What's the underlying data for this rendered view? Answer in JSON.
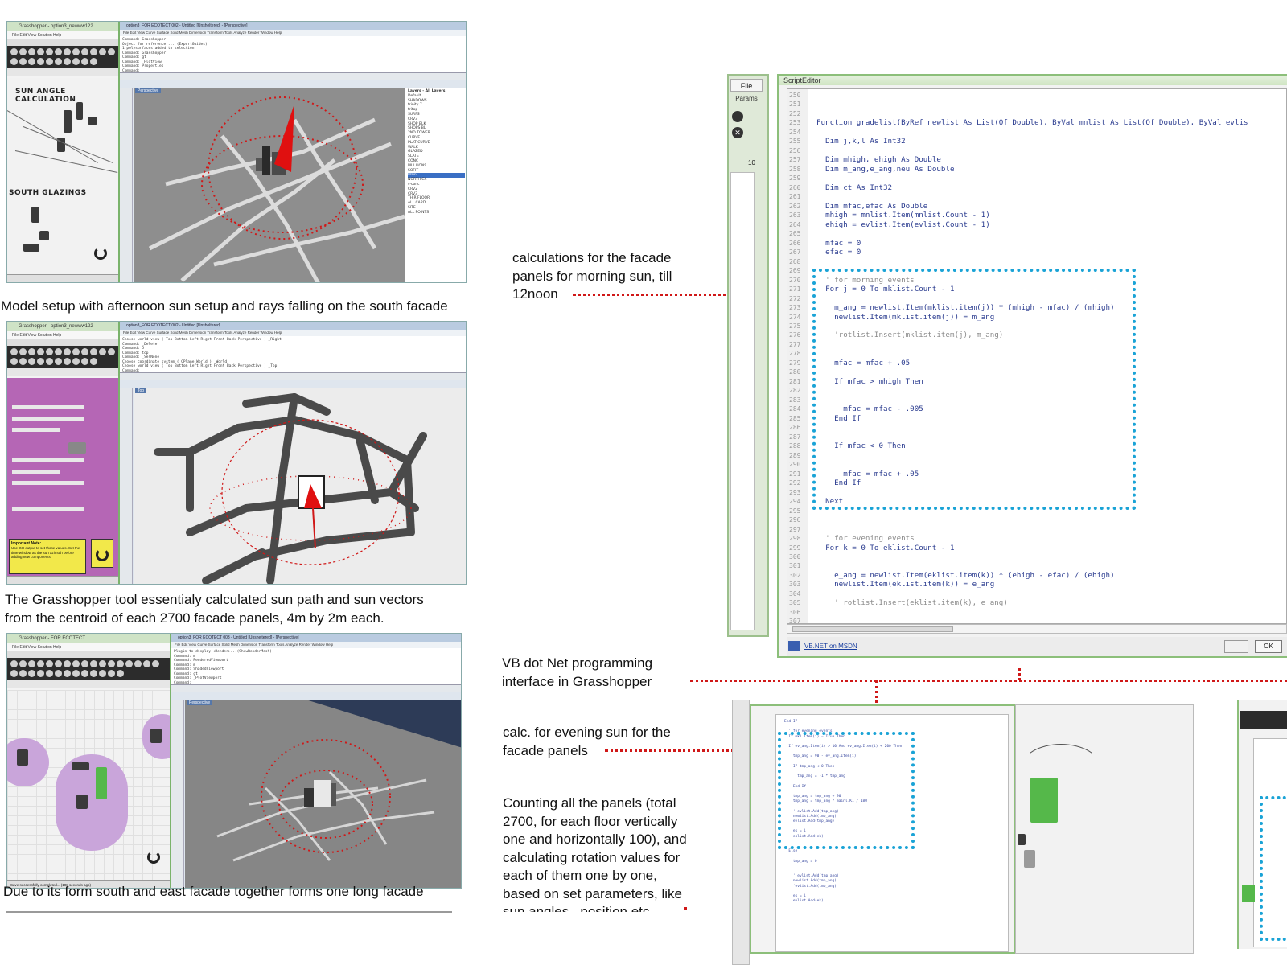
{
  "screens": {
    "top": {
      "gh_title": "Grasshopper - option3_newww122",
      "gh_menu": "File  Edit  View  Solution  Help",
      "label_sun": "SUN ANGLE CALCULATION",
      "label_south": "SOUTH GLAZINGS",
      "rhino_title": "option3_FOR ECOTECT 002 - Untitled [Unsheltered] - [Perspective]",
      "rhino_menu": "File  Edit  View  Curve  Surface  Solid  Mesh  Dimension  Transform  Tools  Analyze  Render  Window  Help",
      "cmd_lines": [
        "Command: Grasshopper",
        "Object for reference ... (ExportGuides)",
        "1 polysurfaces added to selection",
        "Command: Grasshopper",
        "Command: gt",
        "Command: _PlotView",
        "Command: Properties",
        "Command:"
      ],
      "viewport": "Perspective",
      "layers_title": "Layers - All Layers",
      "layers": [
        "Default",
        "SHADOWS",
        "trinity 7",
        "tritop",
        "SURFS",
        "CRV3",
        "SHOP BLK",
        "SHOPS BL",
        "2ND TOWER",
        "CURVE",
        "PLAT CURVE",
        "WALK",
        "GLAZED",
        "SLATE",
        "CONC",
        "MULLIONS",
        "SOFIT",
        "Main",
        "NORTH CX",
        "s-conc",
        "CRV2",
        "CRV3",
        "THIR FLOOR",
        "ALL CARD",
        "SITE",
        "ALL POINTS"
      ]
    },
    "middle": {
      "gh_title": "Grasshopper - option3_newww122",
      "rhino_title": "option3_FOR ECOTECT 002 - Untitled [Unsheltered]",
      "cmd_lines": [
        "Choose world view ( Top Bottom Left Right Front Back Perspective ) _Right",
        "Command: _Delete",
        "Command: 5",
        "Command: top",
        "Command: _SelNone",
        "Choose coordinate system ( CPlane World ) _World",
        "Choose world view ( Top Bottom Left Right Front Back Perspective ) _Top",
        "Command:"
      ],
      "viewport": "Top",
      "panel_title": "Important Note:",
      "panel_text": "Use GH output to set those values. Set the time window as the sun azimuth before adding new components."
    },
    "bottom": {
      "gh_title": "Grasshopper - FOR ECOTECT",
      "gh_tab": "FOR ECOTECT",
      "rhino_title": "option3_FOR ECOTECT 003 - Untitled [Unsheltered] - [Perspective]",
      "cmd_lines": [
        "Plugin to display <Render>...(ShowRenderMesh)",
        "Command: m",
        "Command: RenderedViewport",
        "Command: m",
        "Command: ShadedViewport",
        "Command: gt",
        "Command: _PlotViewport",
        "Command:"
      ],
      "viewport": "Perspective",
      "status": "Save successfully completed... (108 seconds ago)"
    }
  },
  "captions": {
    "c1": "Model setup with afternoon sun setup and rays falling on the south facade",
    "c2a": "The Grasshopper tool essentialy calculated sun path and sun vectors",
    "c2b": "from the centroid of each 2700 facade panels, 4m by 2m each.",
    "c3": "Due to its form south and east facade together forms one long facade"
  },
  "notes": {
    "morning": [
      "calculations for the facade",
      "panels for morning sun, till",
      "12noon"
    ],
    "vbnet": [
      "VB dot Net programming",
      "interface in Grasshopper"
    ],
    "evening": [
      "calc. for evening sun for the",
      "facade panels"
    ],
    "counting": [
      "Counting all the panels (total",
      "2700, for each floor vertically",
      "one and horizontally 100), and",
      "calculating rotation values for",
      "each of them one by one,",
      "based on set parameters, like",
      "sun angles , position etc"
    ]
  },
  "script_editor": {
    "title": "ScriptEditor",
    "file_button": "File",
    "params_label": "Params",
    "zoom": "10",
    "link": "VB.NET on MSDN",
    "ok": "OK",
    "lines": [
      {
        "n": "250",
        "t": ""
      },
      {
        "n": "251",
        "t": ""
      },
      {
        "n": "252",
        "t": ""
      },
      {
        "n": "253",
        "t": "Function gradelist(ByRef newlist As List(Of Double), ByVal mnlist As List(Of Double), ByVal evlis"
      },
      {
        "n": "254",
        "t": ""
      },
      {
        "n": "255",
        "t": "  Dim j,k,l As Int32"
      },
      {
        "n": "256",
        "t": ""
      },
      {
        "n": "257",
        "t": "  Dim mhigh, ehigh As Double"
      },
      {
        "n": "258",
        "t": "  Dim m_ang,e_ang,neu As Double"
      },
      {
        "n": "259",
        "t": ""
      },
      {
        "n": "260",
        "t": "  Dim ct As Int32"
      },
      {
        "n": "261",
        "t": ""
      },
      {
        "n": "262",
        "t": "  Dim mfac,efac As Double"
      },
      {
        "n": "263",
        "t": "  mhigh = mnlist.Item(mnlist.Count - 1)"
      },
      {
        "n": "264",
        "t": "  ehigh = evlist.Item(evlist.Count - 1)"
      },
      {
        "n": "265",
        "t": ""
      },
      {
        "n": "266",
        "t": "  mfac = 0"
      },
      {
        "n": "267",
        "t": "  efac = 0"
      },
      {
        "n": "268",
        "t": ""
      },
      {
        "n": "269",
        "t": ""
      },
      {
        "n": "270",
        "t": "  ' for morning events",
        "c": true
      },
      {
        "n": "271",
        "t": "  For j = 0 To mklist.Count - 1"
      },
      {
        "n": "272",
        "t": ""
      },
      {
        "n": "273",
        "t": "    m_ang = newlist.Item(mklist.item(j)) * (mhigh - mfac) / (mhigh)"
      },
      {
        "n": "274",
        "t": "    newlist.Item(mklist.item(j)) = m_ang"
      },
      {
        "n": "275",
        "t": ""
      },
      {
        "n": "276",
        "t": "    'rotlist.Insert(mklist.item(j), m_ang)",
        "c": true
      },
      {
        "n": "277",
        "t": ""
      },
      {
        "n": "278",
        "t": ""
      },
      {
        "n": "279",
        "t": "    mfac = mfac + .05"
      },
      {
        "n": "280",
        "t": ""
      },
      {
        "n": "281",
        "t": "    If mfac > mhigh Then"
      },
      {
        "n": "282",
        "t": ""
      },
      {
        "n": "283",
        "t": ""
      },
      {
        "n": "284",
        "t": "      mfac = mfac - .005"
      },
      {
        "n": "285",
        "t": "    End If"
      },
      {
        "n": "286",
        "t": ""
      },
      {
        "n": "287",
        "t": ""
      },
      {
        "n": "288",
        "t": "    If mfac < 0 Then"
      },
      {
        "n": "289",
        "t": ""
      },
      {
        "n": "290",
        "t": ""
      },
      {
        "n": "291",
        "t": "      mfac = mfac + .05"
      },
      {
        "n": "292",
        "t": "    End If"
      },
      {
        "n": "293",
        "t": ""
      },
      {
        "n": "294",
        "t": "  Next"
      },
      {
        "n": "295",
        "t": ""
      },
      {
        "n": "296",
        "t": ""
      },
      {
        "n": "297",
        "t": ""
      },
      {
        "n": "298",
        "t": "  ' for evening events",
        "c": true
      },
      {
        "n": "299",
        "t": "  For k = 0 To eklist.Count - 1"
      },
      {
        "n": "300",
        "t": ""
      },
      {
        "n": "301",
        "t": ""
      },
      {
        "n": "302",
        "t": "    e_ang = newlist.Item(eklist.item(k)) * (ehigh - efac) / (ehigh)"
      },
      {
        "n": "303",
        "t": "    newlist.Item(eklist.item(k)) = e_ang"
      },
      {
        "n": "304",
        "t": ""
      },
      {
        "n": "305",
        "t": "    ' rotlist.Insert(eklist.item(k), e_ang)",
        "c": true
      },
      {
        "n": "306",
        "t": ""
      },
      {
        "n": "307",
        "t": ""
      }
    ]
  },
  "small_editor": {
    "lines": [
      "End If",
      "",
      "  ' for evening events",
      "  If mkl.Item(i) = True Then",
      "",
      "  If ev_ang.Item(i) > 10 And ev_ang.Item(i) < 200 Then",
      "",
      "    tmp_ang = 90 - ev_ang.Item(i)",
      "",
      "    If tmp_ang < 0 Then",
      "",
      "      tmp_ang = -1 * tmp_ang",
      "",
      "    End If",
      "",
      "    tmp_ang = tmp_ang + 90",
      "    tmp_ang = tmp_ang * mainl.K1 / 180",
      "",
      "    ' evlist.Add(tmp_ang)",
      "    newlist.Add(tmp_ang)",
      "    evlist.Add(tmp_ang)",
      "",
      "    ek = i",
      "    eklist.Add(ek)",
      "",
      "",
      "  Else",
      "",
      "    tmp_ang = 0",
      "",
      "",
      "    ' evlist.Add(tmp_ang)",
      "    newlist.Add(tmp_ang)",
      "    'evlist.Add(tmp_ang)",
      "",
      "    ek = i",
      "    evlist.Add(ek)"
    ]
  },
  "colors": {
    "annotation_red": "#d01818",
    "highlight_blue": "#1aa3d6",
    "gh_green": "#7ab36b",
    "gh_purple_canvas": "#b566b5",
    "viewport_grey": "#8e8e8e",
    "sun_red": "#e01010"
  }
}
